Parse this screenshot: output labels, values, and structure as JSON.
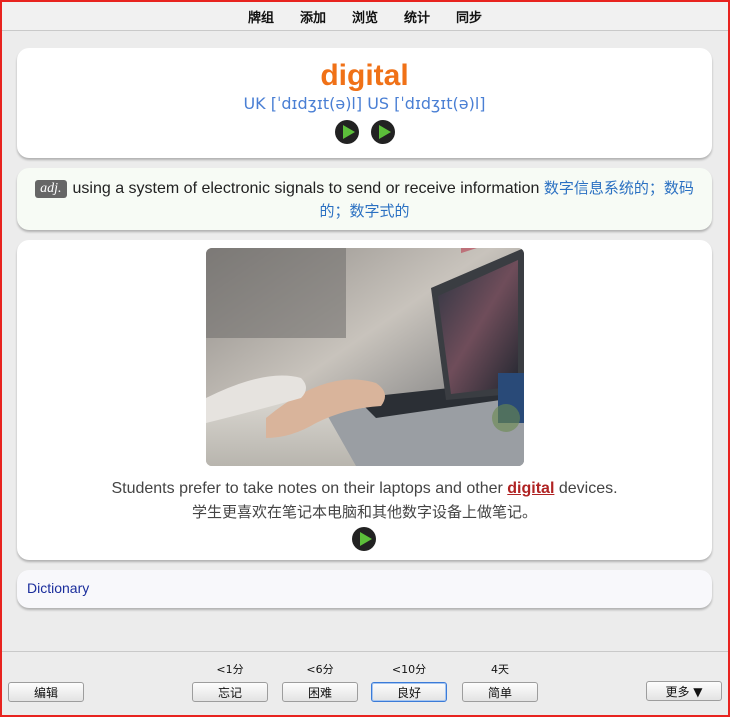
{
  "menu": [
    "牌组",
    "添加",
    "浏览",
    "统计",
    "同步"
  ],
  "word": {
    "text": "digital",
    "phonetic": "UK [ˈdɪdʒɪt(ə)l] US [ˈdɪdʒɪt(ə)l]",
    "color": "#f07117"
  },
  "definition": {
    "pos": "adj.",
    "en": "using a system of electronic signals to send or receive information",
    "cn": "数字信息系统的；数码的；数字式的"
  },
  "example": {
    "en_before": "Students prefer to take notes on their laptops and other ",
    "en_highlight": "digital",
    "en_after": " devices.",
    "cn": "学生更喜欢在笔记本电脑和其他数字设备上做笔记。"
  },
  "dictionary": {
    "label": "Dictionary"
  },
  "footer": {
    "edit": "编辑",
    "more": "更多 ▼",
    "answers": [
      {
        "interval": "<1分",
        "label": "忘记"
      },
      {
        "interval": "<6分",
        "label": "困难"
      },
      {
        "interval": "<10分",
        "label": "良好"
      },
      {
        "interval": "4天",
        "label": "简单"
      }
    ]
  }
}
